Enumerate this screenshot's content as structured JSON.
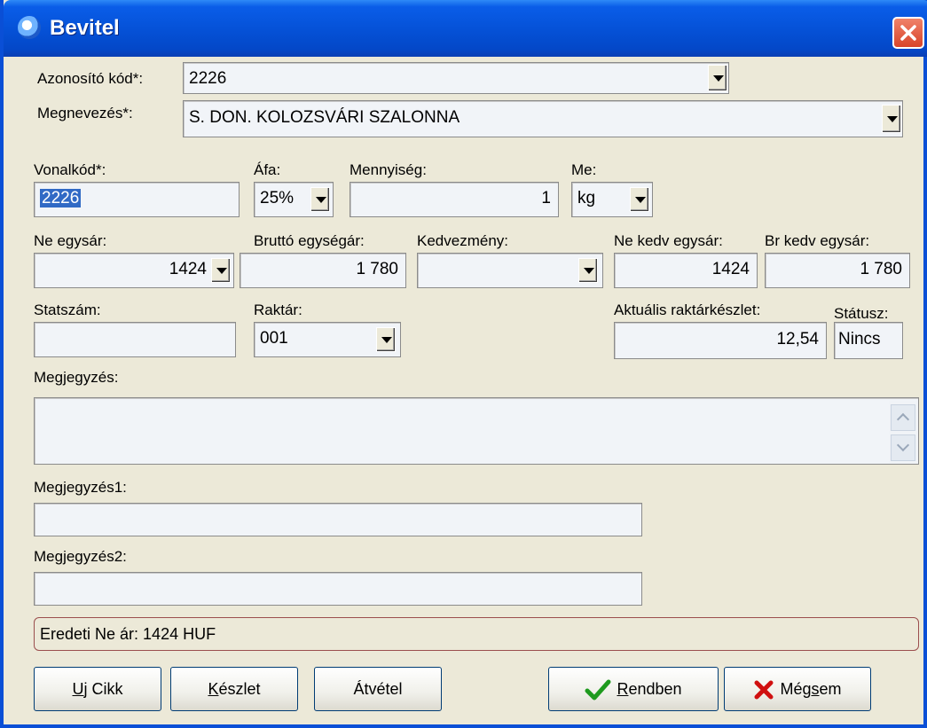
{
  "window": {
    "title": "Bevitel"
  },
  "fields": {
    "azonosito_label": "Azonosító kód*:",
    "azonosito_value": "2226",
    "megnevezes_label": "Megnevezés*:",
    "megnevezes_value": "S. DON. KOLOZSVÁRI SZALONNA",
    "vonalkod_label": "Vonalkód*:",
    "vonalkod_value": "2226",
    "afa_label": "Áfa:",
    "afa_value": "25%",
    "mennyiseg_label": "Mennyiség:",
    "mennyiseg_value": "1",
    "me_label": "Me:",
    "me_value": "kg",
    "ne_egysar_label": "Ne egysár:",
    "ne_egysar_value": "1424",
    "brutto_label": "Bruttó egységár:",
    "brutto_value": "1 780",
    "kedvezmeny_label": "Kedvezmény:",
    "kedvezmeny_value": "",
    "ne_kedv_label": "Ne kedv egysár:",
    "ne_kedv_value": "1424",
    "br_kedv_label": "Br kedv egysár:",
    "br_kedv_value": "1 780",
    "statszam_label": "Statszám:",
    "statszam_value": "",
    "raktar_label": "Raktár:",
    "raktar_value": "001",
    "keszlet_label": "Aktuális raktárkészlet:",
    "keszlet_value": "12,54",
    "statusz_label": "Státusz:",
    "statusz_value": "Nincs",
    "megjegyzes_label": "Megjegyzés:",
    "megjegyzes1_label": "Megjegyzés1:",
    "megjegyzes2_label": "Megjegyzés2:"
  },
  "info": {
    "text": "Eredeti Ne ár: 1424 HUF"
  },
  "buttons": {
    "uj_cikk_u": "U",
    "uj_cikk_rest": "j Cikk",
    "keszlet_u": "K",
    "keszlet_rest": "észlet",
    "atvetel": "Átvétel",
    "rendben_u": "R",
    "rendben_rest": "endben",
    "megsem_pre": "Még",
    "megsem_u": "s",
    "megsem_rest": "em"
  },
  "colors": {
    "titlebar": "#0552D8",
    "face": "#ECE9D8",
    "selection": "#316AC5"
  }
}
